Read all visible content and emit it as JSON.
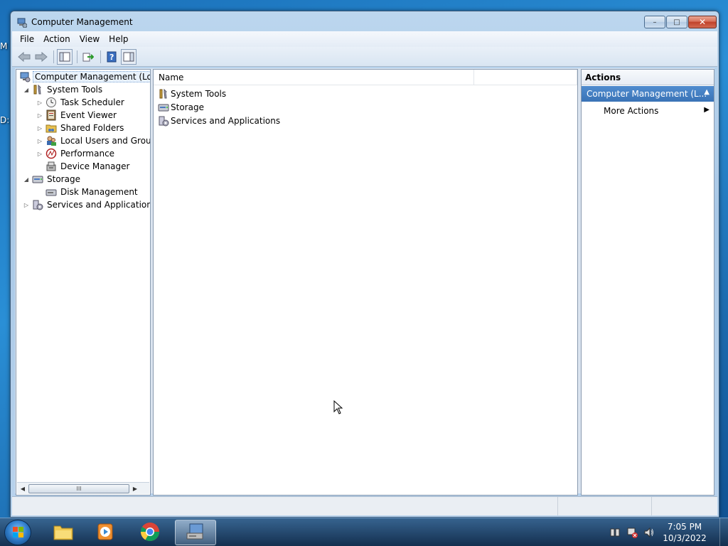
{
  "desktop": {
    "label_1": "M",
    "label_2": "D:"
  },
  "window": {
    "title": "Computer Management",
    "caption": {
      "minimize": "–",
      "maximize": "□",
      "close": "✕"
    }
  },
  "menu": {
    "file": "File",
    "action": "Action",
    "view": "View",
    "help": "Help"
  },
  "toolbar": {
    "icons": [
      "back-icon",
      "forward-icon",
      "show-hide-tree-icon",
      "export-list-icon",
      "help-icon",
      "show-hide-action-pane-icon"
    ]
  },
  "tree": {
    "root": "Computer Management (Local",
    "system_tools": "System Tools",
    "task_scheduler": "Task Scheduler",
    "event_viewer": "Event Viewer",
    "shared_folders": "Shared Folders",
    "local_users": "Local Users and Groups",
    "performance": "Performance",
    "device_manager": "Device Manager",
    "storage": "Storage",
    "disk_management": "Disk Management",
    "services_apps": "Services and Applications",
    "scroll_grip": "III"
  },
  "list": {
    "column_name": "Name",
    "items": [
      "System Tools",
      "Storage",
      "Services and Applications"
    ]
  },
  "actions": {
    "header": "Actions",
    "section": "Computer Management (L...",
    "more_actions": "More Actions"
  },
  "taskbar": {
    "time": "7:05 PM",
    "date": "10/3/2022"
  }
}
